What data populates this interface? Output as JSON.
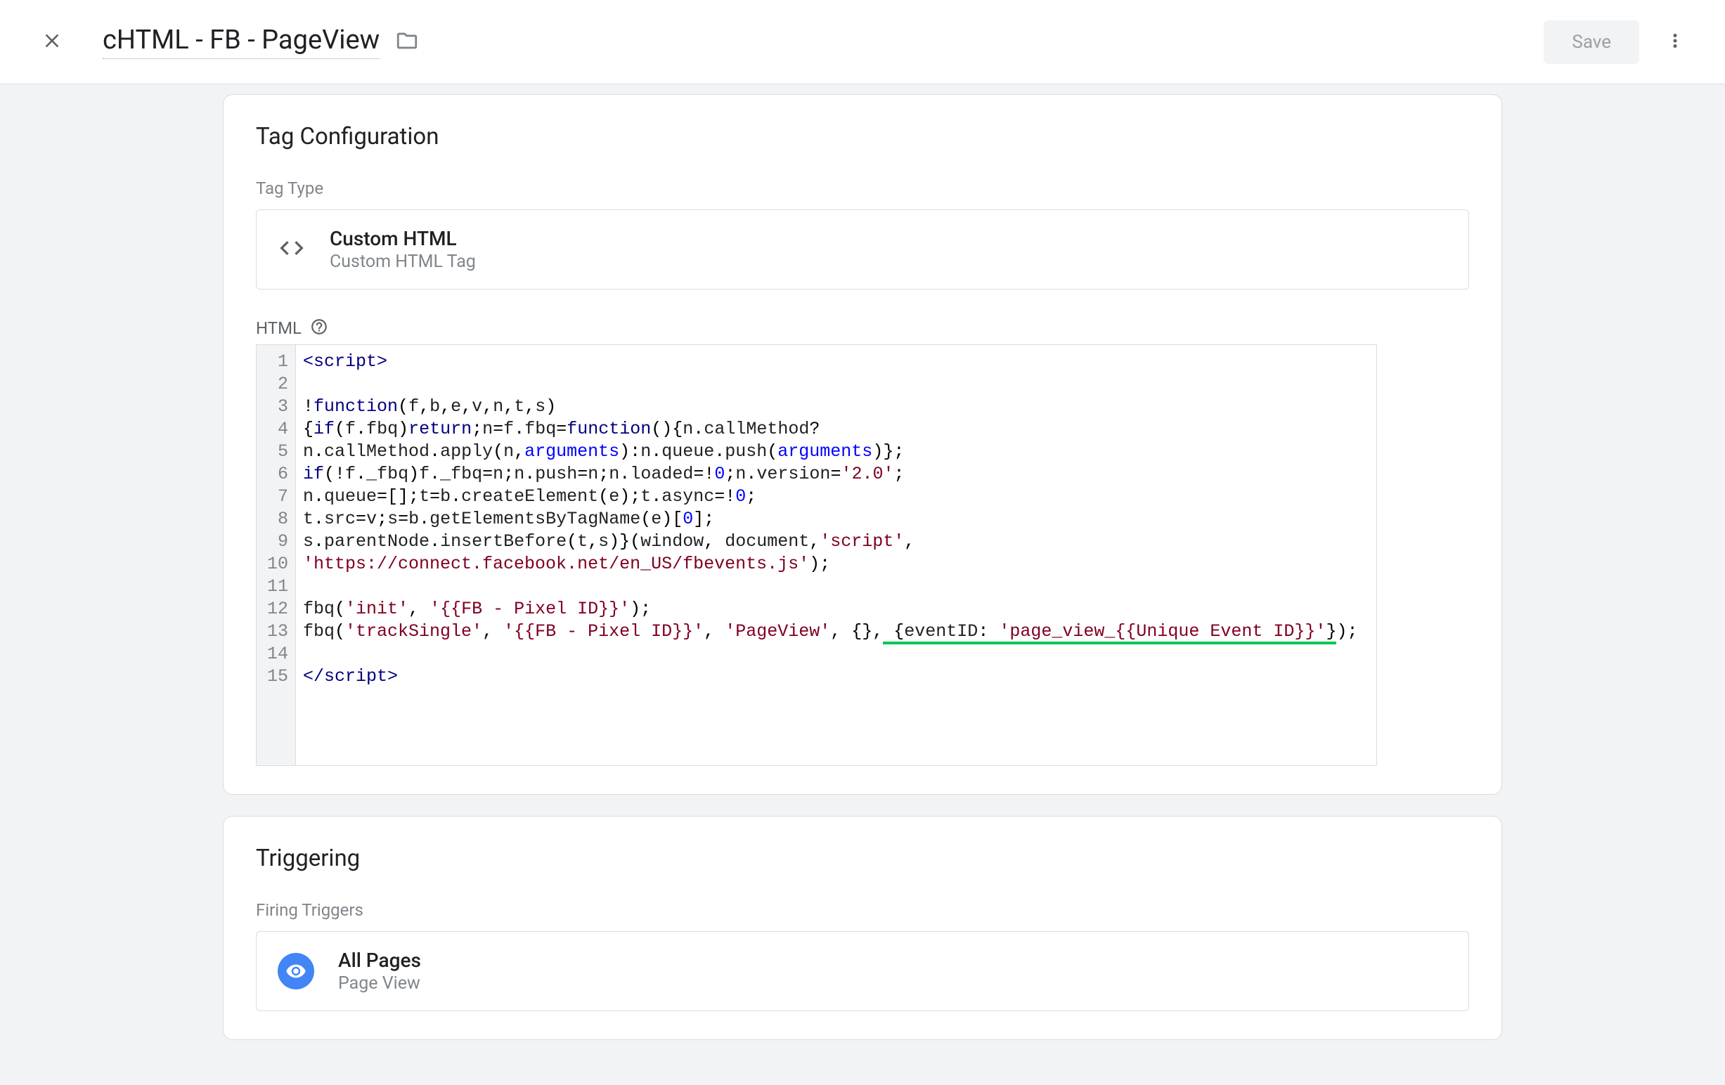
{
  "header": {
    "title": "cHTML - FB - PageView",
    "save_label": "Save"
  },
  "config": {
    "card_title": "Tag Configuration",
    "tag_type_label": "Tag Type",
    "tag_type_title": "Custom HTML",
    "tag_type_sub": "Custom HTML Tag",
    "html_label": "HTML",
    "code_lines": [
      {
        "n": 1,
        "html": "<span class='tok-tag'>&lt;script&gt;</span>"
      },
      {
        "n": 2,
        "html": ""
      },
      {
        "n": 3,
        "html": "<span class='tok-punc'>!</span><span class='tok-kw'>function</span><span class='tok-punc'>(</span>f<span class='tok-punc'>,</span>b<span class='tok-punc'>,</span>e<span class='tok-punc'>,</span>v<span class='tok-punc'>,</span>n<span class='tok-punc'>,</span>t<span class='tok-punc'>,</span>s<span class='tok-punc'>)</span>"
      },
      {
        "n": 4,
        "html": "<span class='tok-punc'>{</span><span class='tok-kw'>if</span><span class='tok-punc'>(</span>f<span class='tok-punc'>.</span>fbq<span class='tok-punc'>)</span><span class='tok-kw'>return</span><span class='tok-punc'>;</span>n<span class='tok-punc'>=</span>f<span class='tok-punc'>.</span>fbq<span class='tok-punc'>=</span><span class='tok-kw'>function</span><span class='tok-punc'>(){</span>n<span class='tok-punc'>.</span>callMethod<span class='tok-punc'>?</span>"
      },
      {
        "n": 5,
        "html": "n<span class='tok-punc'>.</span>callMethod<span class='tok-punc'>.</span>apply<span class='tok-punc'>(</span>n<span class='tok-punc'>,</span><span class='tok-builtin'>arguments</span><span class='tok-punc'>):</span>n<span class='tok-punc'>.</span>queue<span class='tok-punc'>.</span>push<span class='tok-punc'>(</span><span class='tok-builtin'>arguments</span><span class='tok-punc'>)};</span>"
      },
      {
        "n": 6,
        "html": "<span class='tok-kw'>if</span><span class='tok-punc'>(!</span>f<span class='tok-punc'>.</span>_fbq<span class='tok-punc'>)</span>f<span class='tok-punc'>.</span>_fbq<span class='tok-punc'>=</span>n<span class='tok-punc'>;</span>n<span class='tok-punc'>.</span>push<span class='tok-punc'>=</span>n<span class='tok-punc'>;</span>n<span class='tok-punc'>.</span>loaded<span class='tok-punc'>=!</span><span class='tok-num'>0</span><span class='tok-punc'>;</span>n<span class='tok-punc'>.</span>version<span class='tok-punc'>=</span><span class='tok-str'>'2.0'</span><span class='tok-punc'>;</span>"
      },
      {
        "n": 7,
        "html": "n<span class='tok-punc'>.</span>queue<span class='tok-punc'>=[];</span>t<span class='tok-punc'>=</span>b<span class='tok-punc'>.</span>createElement<span class='tok-punc'>(</span>e<span class='tok-punc'>);</span>t<span class='tok-punc'>.</span>async<span class='tok-punc'>=!</span><span class='tok-num'>0</span><span class='tok-punc'>;</span>"
      },
      {
        "n": 8,
        "html": "t<span class='tok-punc'>.</span>src<span class='tok-punc'>=</span>v<span class='tok-punc'>;</span>s<span class='tok-punc'>=</span>b<span class='tok-punc'>.</span>getElementsByTagName<span class='tok-punc'>(</span>e<span class='tok-punc'>)[</span><span class='tok-num'>0</span><span class='tok-punc'>];</span>"
      },
      {
        "n": 9,
        "html": "s<span class='tok-punc'>.</span>parentNode<span class='tok-punc'>.</span>insertBefore<span class='tok-punc'>(</span>t<span class='tok-punc'>,</span>s<span class='tok-punc'>)}(</span>window<span class='tok-punc'>,</span> document<span class='tok-punc'>,</span><span class='tok-str'>'script'</span><span class='tok-punc'>,</span>"
      },
      {
        "n": 10,
        "html": "<span class='tok-str'>'https://connect.facebook.net/en_US/fbevents.js'</span><span class='tok-punc'>);</span>"
      },
      {
        "n": 11,
        "html": ""
      },
      {
        "n": 12,
        "html": "fbq<span class='tok-punc'>(</span><span class='tok-str'>'init'</span><span class='tok-punc'>,</span> <span class='tok-str'>'{{FB - Pixel ID}}'</span><span class='tok-punc'>);</span>"
      },
      {
        "n": 13,
        "html": "fbq<span class='tok-punc'>(</span><span class='tok-str'>'trackSingle'</span><span class='tok-punc'>,</span> <span class='tok-str'>'{{FB - Pixel ID}}'</span><span class='tok-punc'>,</span> <span class='tok-str'>'PageView'</span><span class='tok-punc'>,</span> <span class='tok-punc'>{},</span><span class='underline-green'> <span class='tok-punc'>{</span>eventID<span class='tok-punc'>:</span> <span class='tok-str'>'page_view_{{Unique Event ID}}'</span><span class='tok-punc'>}</span></span><span class='tok-punc'>);</span>"
      },
      {
        "n": 14,
        "html": ""
      },
      {
        "n": 15,
        "html": "<span class='tok-tag'>&lt;/script&gt;</span>"
      }
    ]
  },
  "trigger": {
    "card_title": "Triggering",
    "section_label": "Firing Triggers",
    "title": "All Pages",
    "sub": "Page View"
  }
}
